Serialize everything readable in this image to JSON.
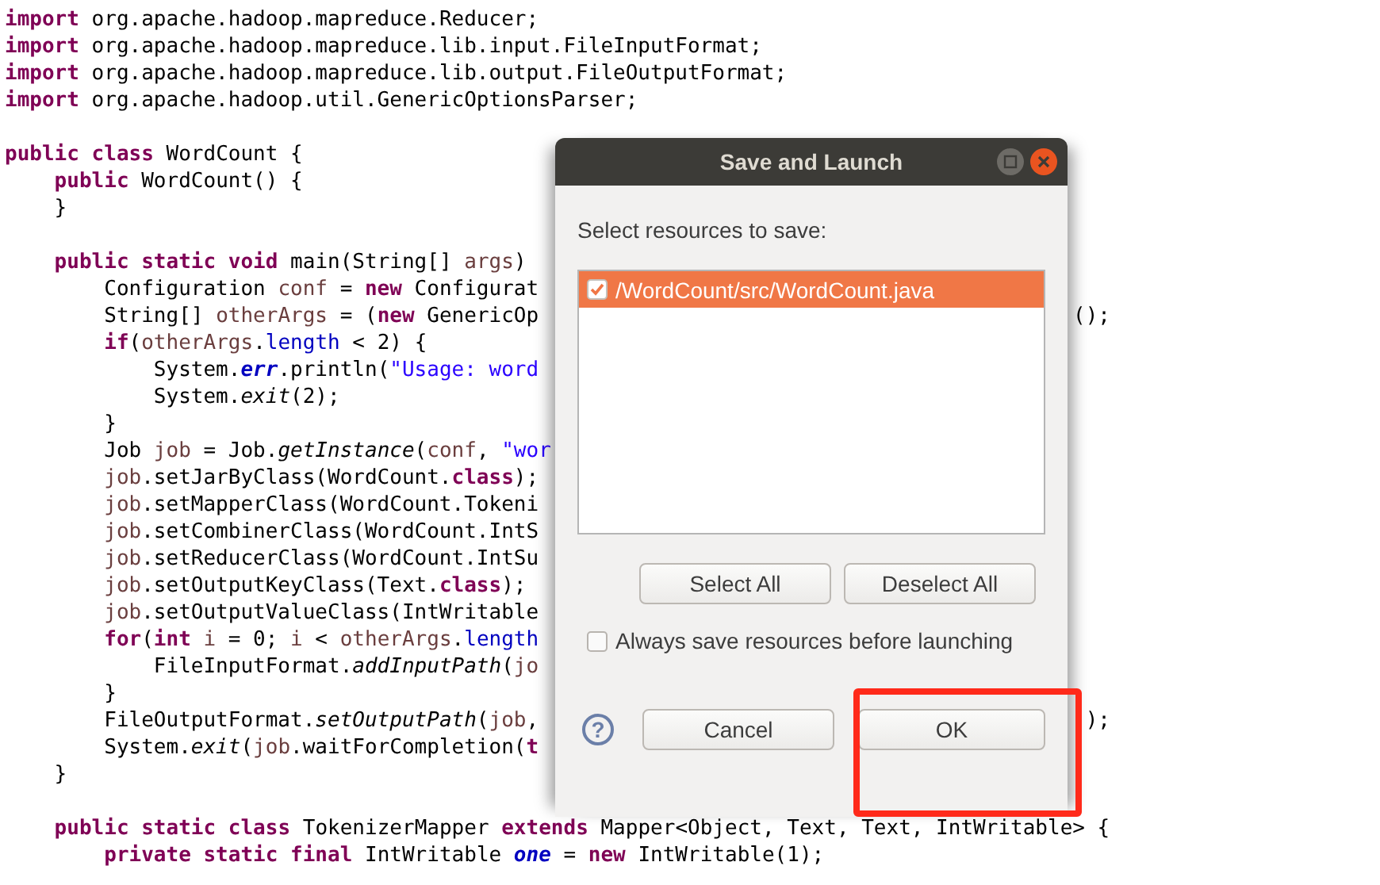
{
  "editor": {
    "lines": [
      {
        "kind": "code",
        "tokens": [
          {
            "kind": "kw",
            "text": "import"
          },
          {
            "kind": "plain",
            "text": " org.apache.hadoop.mapreduce.Reducer;"
          }
        ]
      },
      {
        "kind": "code",
        "tokens": [
          {
            "kind": "kw",
            "text": "import"
          },
          {
            "kind": "plain",
            "text": " org.apache.hadoop.mapreduce.lib.input.FileInputFormat;"
          }
        ]
      },
      {
        "kind": "code",
        "tokens": [
          {
            "kind": "kw",
            "text": "import"
          },
          {
            "kind": "plain",
            "text": " org.apache.hadoop.mapreduce.lib.output.FileOutputFormat;"
          }
        ]
      },
      {
        "kind": "code",
        "tokens": [
          {
            "kind": "kw",
            "text": "import"
          },
          {
            "kind": "plain",
            "text": " org.apache.hadoop.util.GenericOptionsParser;"
          }
        ]
      },
      {
        "kind": "blank"
      },
      {
        "kind": "code",
        "tokens": [
          {
            "kind": "kw",
            "text": "public"
          },
          {
            "kind": "kw",
            "text": " class"
          },
          {
            "kind": "plain",
            "text": " WordCount {"
          }
        ]
      },
      {
        "kind": "code",
        "tokens": [
          {
            "kind": "kw",
            "text": "    public"
          },
          {
            "kind": "plain",
            "text": " WordCount() {"
          }
        ]
      },
      {
        "kind": "code",
        "tokens": [
          {
            "kind": "plain",
            "text": "    }"
          }
        ]
      },
      {
        "kind": "blank"
      },
      {
        "kind": "code",
        "tokens": [
          {
            "kind": "kw",
            "text": "    public"
          },
          {
            "kind": "kw",
            "text": " static"
          },
          {
            "kind": "kw",
            "text": " void"
          },
          {
            "kind": "plain",
            "text": " main(String[] "
          },
          {
            "kind": "var",
            "text": "args"
          },
          {
            "kind": "plain",
            "text": ")"
          }
        ]
      },
      {
        "kind": "code",
        "tokens": [
          {
            "kind": "plain",
            "text": "        Configuration "
          },
          {
            "kind": "var",
            "text": "conf"
          },
          {
            "kind": "plain",
            "text": " = "
          },
          {
            "kind": "kw",
            "text": "new"
          },
          {
            "kind": "plain",
            "text": " Configurat"
          }
        ]
      },
      {
        "kind": "code",
        "tokens": [
          {
            "kind": "plain",
            "text": "        String[] "
          },
          {
            "kind": "var",
            "text": "otherArgs"
          },
          {
            "kind": "plain",
            "text": " = ("
          },
          {
            "kind": "kw",
            "text": "new"
          },
          {
            "kind": "plain",
            "text": " GenericOp"
          }
        ],
        "tail": "();"
      },
      {
        "kind": "code",
        "tokens": [
          {
            "kind": "kw",
            "text": "        if"
          },
          {
            "kind": "plain",
            "text": "("
          },
          {
            "kind": "var",
            "text": "otherArgs"
          },
          {
            "kind": "plain",
            "text": "."
          },
          {
            "kind": "field",
            "text": "length"
          },
          {
            "kind": "plain",
            "text": " < 2) {"
          }
        ]
      },
      {
        "kind": "code",
        "tokens": [
          {
            "kind": "plain",
            "text": "            System."
          },
          {
            "kind": "sfield",
            "text": "err"
          },
          {
            "kind": "plain",
            "text": ".println("
          },
          {
            "kind": "str",
            "text": "\"Usage: word"
          }
        ]
      },
      {
        "kind": "code",
        "tokens": [
          {
            "kind": "plain",
            "text": "            System."
          },
          {
            "kind": "smethod",
            "text": "exit"
          },
          {
            "kind": "plain",
            "text": "(2);"
          }
        ]
      },
      {
        "kind": "code",
        "tokens": [
          {
            "kind": "plain",
            "text": "        }"
          }
        ]
      },
      {
        "kind": "code",
        "tokens": [
          {
            "kind": "plain",
            "text": "        Job "
          },
          {
            "kind": "var",
            "text": "job"
          },
          {
            "kind": "plain",
            "text": " = Job."
          },
          {
            "kind": "smethod",
            "text": "getInstance"
          },
          {
            "kind": "plain",
            "text": "("
          },
          {
            "kind": "var",
            "text": "conf"
          },
          {
            "kind": "plain",
            "text": ", "
          },
          {
            "kind": "str",
            "text": "\"wor"
          }
        ]
      },
      {
        "kind": "code",
        "tokens": [
          {
            "kind": "var",
            "text": "        job"
          },
          {
            "kind": "plain",
            "text": ".setJarByClass(WordCount."
          },
          {
            "kind": "kw",
            "text": "class"
          },
          {
            "kind": "plain",
            "text": ");"
          }
        ]
      },
      {
        "kind": "code",
        "tokens": [
          {
            "kind": "var",
            "text": "        job"
          },
          {
            "kind": "plain",
            "text": ".setMapperClass(WordCount.Tokeni"
          }
        ]
      },
      {
        "kind": "code",
        "tokens": [
          {
            "kind": "var",
            "text": "        job"
          },
          {
            "kind": "plain",
            "text": ".setCombinerClass(WordCount.IntS"
          }
        ]
      },
      {
        "kind": "code",
        "tokens": [
          {
            "kind": "var",
            "text": "        job"
          },
          {
            "kind": "plain",
            "text": ".setReducerClass(WordCount.IntSu"
          }
        ]
      },
      {
        "kind": "code",
        "tokens": [
          {
            "kind": "var",
            "text": "        job"
          },
          {
            "kind": "plain",
            "text": ".setOutputKeyClass(Text."
          },
          {
            "kind": "kw",
            "text": "class"
          },
          {
            "kind": "plain",
            "text": ");"
          }
        ]
      },
      {
        "kind": "code",
        "tokens": [
          {
            "kind": "var",
            "text": "        job"
          },
          {
            "kind": "plain",
            "text": ".setOutputValueClass(IntWritable"
          }
        ]
      },
      {
        "kind": "code",
        "tokens": [
          {
            "kind": "kw",
            "text": "        for"
          },
          {
            "kind": "plain",
            "text": "("
          },
          {
            "kind": "kw",
            "text": "int"
          },
          {
            "kind": "var",
            "text": " i"
          },
          {
            "kind": "plain",
            "text": " = 0; "
          },
          {
            "kind": "var",
            "text": "i"
          },
          {
            "kind": "plain",
            "text": " < "
          },
          {
            "kind": "var",
            "text": "otherArgs"
          },
          {
            "kind": "plain",
            "text": "."
          },
          {
            "kind": "field",
            "text": "length"
          }
        ]
      },
      {
        "kind": "code",
        "tokens": [
          {
            "kind": "plain",
            "text": "            FileInputFormat."
          },
          {
            "kind": "smethod",
            "text": "addInputPath"
          },
          {
            "kind": "plain",
            "text": "("
          },
          {
            "kind": "var",
            "text": "jo"
          }
        ]
      },
      {
        "kind": "code",
        "tokens": [
          {
            "kind": "plain",
            "text": "        }"
          }
        ]
      },
      {
        "kind": "code",
        "tokens": [
          {
            "kind": "plain",
            "text": "        FileOutputFormat."
          },
          {
            "kind": "smethod",
            "text": "setOutputPath"
          },
          {
            "kind": "plain",
            "text": "("
          },
          {
            "kind": "var",
            "text": "job"
          },
          {
            "kind": "plain",
            "text": ","
          }
        ],
        "tail": ");"
      },
      {
        "kind": "code",
        "tokens": [
          {
            "kind": "plain",
            "text": "        System."
          },
          {
            "kind": "smethod",
            "text": "exit"
          },
          {
            "kind": "plain",
            "text": "("
          },
          {
            "kind": "var",
            "text": "job"
          },
          {
            "kind": "plain",
            "text": ".waitForCompletion("
          },
          {
            "kind": "kw",
            "text": "t"
          }
        ]
      },
      {
        "kind": "code",
        "tokens": [
          {
            "kind": "plain",
            "text": "    }"
          }
        ]
      },
      {
        "kind": "blank"
      },
      {
        "kind": "code",
        "tokens": [
          {
            "kind": "kw",
            "text": "    public"
          },
          {
            "kind": "kw",
            "text": " static"
          },
          {
            "kind": "kw",
            "text": " class"
          },
          {
            "kind": "plain",
            "text": " TokenizerMapper "
          },
          {
            "kind": "kw",
            "text": "extends"
          },
          {
            "kind": "plain",
            "text": " Mapper<Object, Text, Text, IntWritable> {"
          }
        ]
      },
      {
        "kind": "code",
        "tokens": [
          {
            "kind": "kw",
            "text": "        private"
          },
          {
            "kind": "kw",
            "text": " static"
          },
          {
            "kind": "kw",
            "text": " final"
          },
          {
            "kind": "plain",
            "text": " IntWritable "
          },
          {
            "kind": "sfield",
            "text": "one"
          },
          {
            "kind": "plain",
            "text": " = "
          },
          {
            "kind": "kw",
            "text": "new"
          },
          {
            "kind": "plain",
            "text": " IntWritable(1);"
          }
        ]
      }
    ]
  },
  "dialog": {
    "title": "Save and Launch",
    "prompt": "Select resources to save:",
    "resources": [
      {
        "label": "/WordCount/src/WordCount.java",
        "checked": true,
        "selected": true
      }
    ],
    "list_buttons": [
      "Select All",
      "Deselect All"
    ],
    "always_save": {
      "label": "Always save resources before launching",
      "checked": false
    },
    "help_icon": "?",
    "buttons": [
      "Cancel",
      "OK"
    ]
  },
  "annotations": [
    {
      "kind": "box"
    }
  ]
}
